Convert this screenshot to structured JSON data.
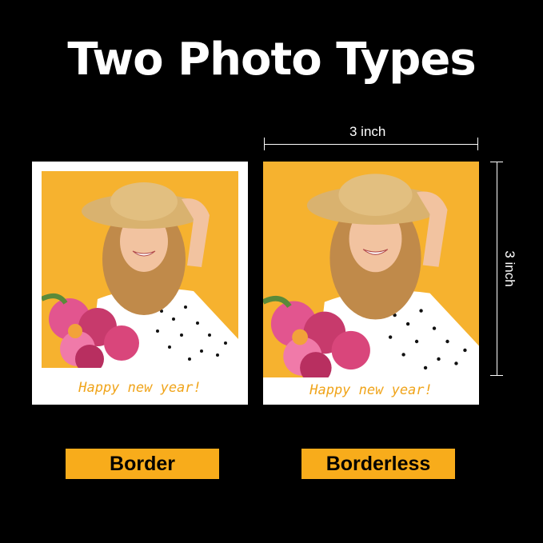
{
  "title": "Two Photo Types",
  "photos": {
    "border": {
      "caption": "Happy new year!",
      "label": "Border"
    },
    "borderless": {
      "caption": "Happy new year!",
      "label": "Borderless"
    }
  },
  "dimensions": {
    "width_label": "3 inch",
    "height_label": "3 inch"
  },
  "colors": {
    "background": "#000000",
    "photo_background": "#f6b22f",
    "caption_text": "#f0a41a",
    "label_box": "#f8ac1b"
  }
}
